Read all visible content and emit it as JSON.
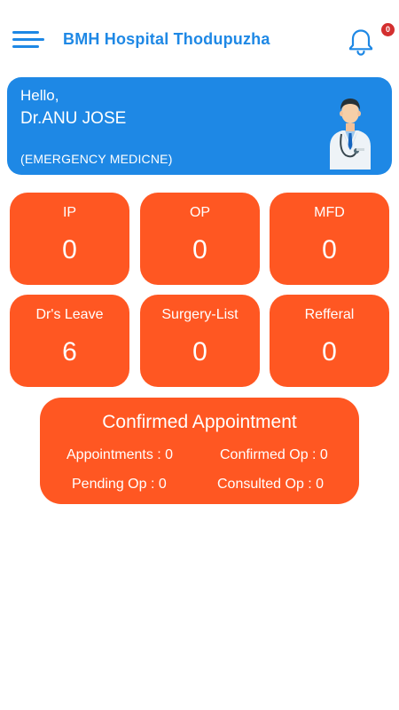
{
  "app_bar": {
    "title": "BMH Hospital Thodupuzha",
    "menu_icon": "menu-icon",
    "notification_icon": "bell-icon",
    "notification_count": "0",
    "accent_color": "#1e88e5"
  },
  "profile": {
    "greeting": "Hello,",
    "name": "Dr.ANU JOSE",
    "department": "(EMERGENCY MEDICNE)",
    "avatar_icon": "doctor-avatar-icon",
    "card_color": "#1e88e5"
  },
  "tiles": [
    {
      "label": "IP",
      "value": "0"
    },
    {
      "label": "OP",
      "value": "0"
    },
    {
      "label": "MFD",
      "value": "0"
    },
    {
      "label": "Dr's Leave",
      "value": "6"
    },
    {
      "label": "Surgery-List",
      "value": "0"
    },
    {
      "label": "Refferal",
      "value": "0"
    }
  ],
  "tile_color": "#ff5722",
  "appointments": {
    "title": "Confirmed Appointment",
    "appointments": "Appointments : 0",
    "confirmed_op": "Confirmed Op : 0",
    "pending_op": "Pending Op : 0",
    "consulted_op": "Consulted Op : 0"
  }
}
